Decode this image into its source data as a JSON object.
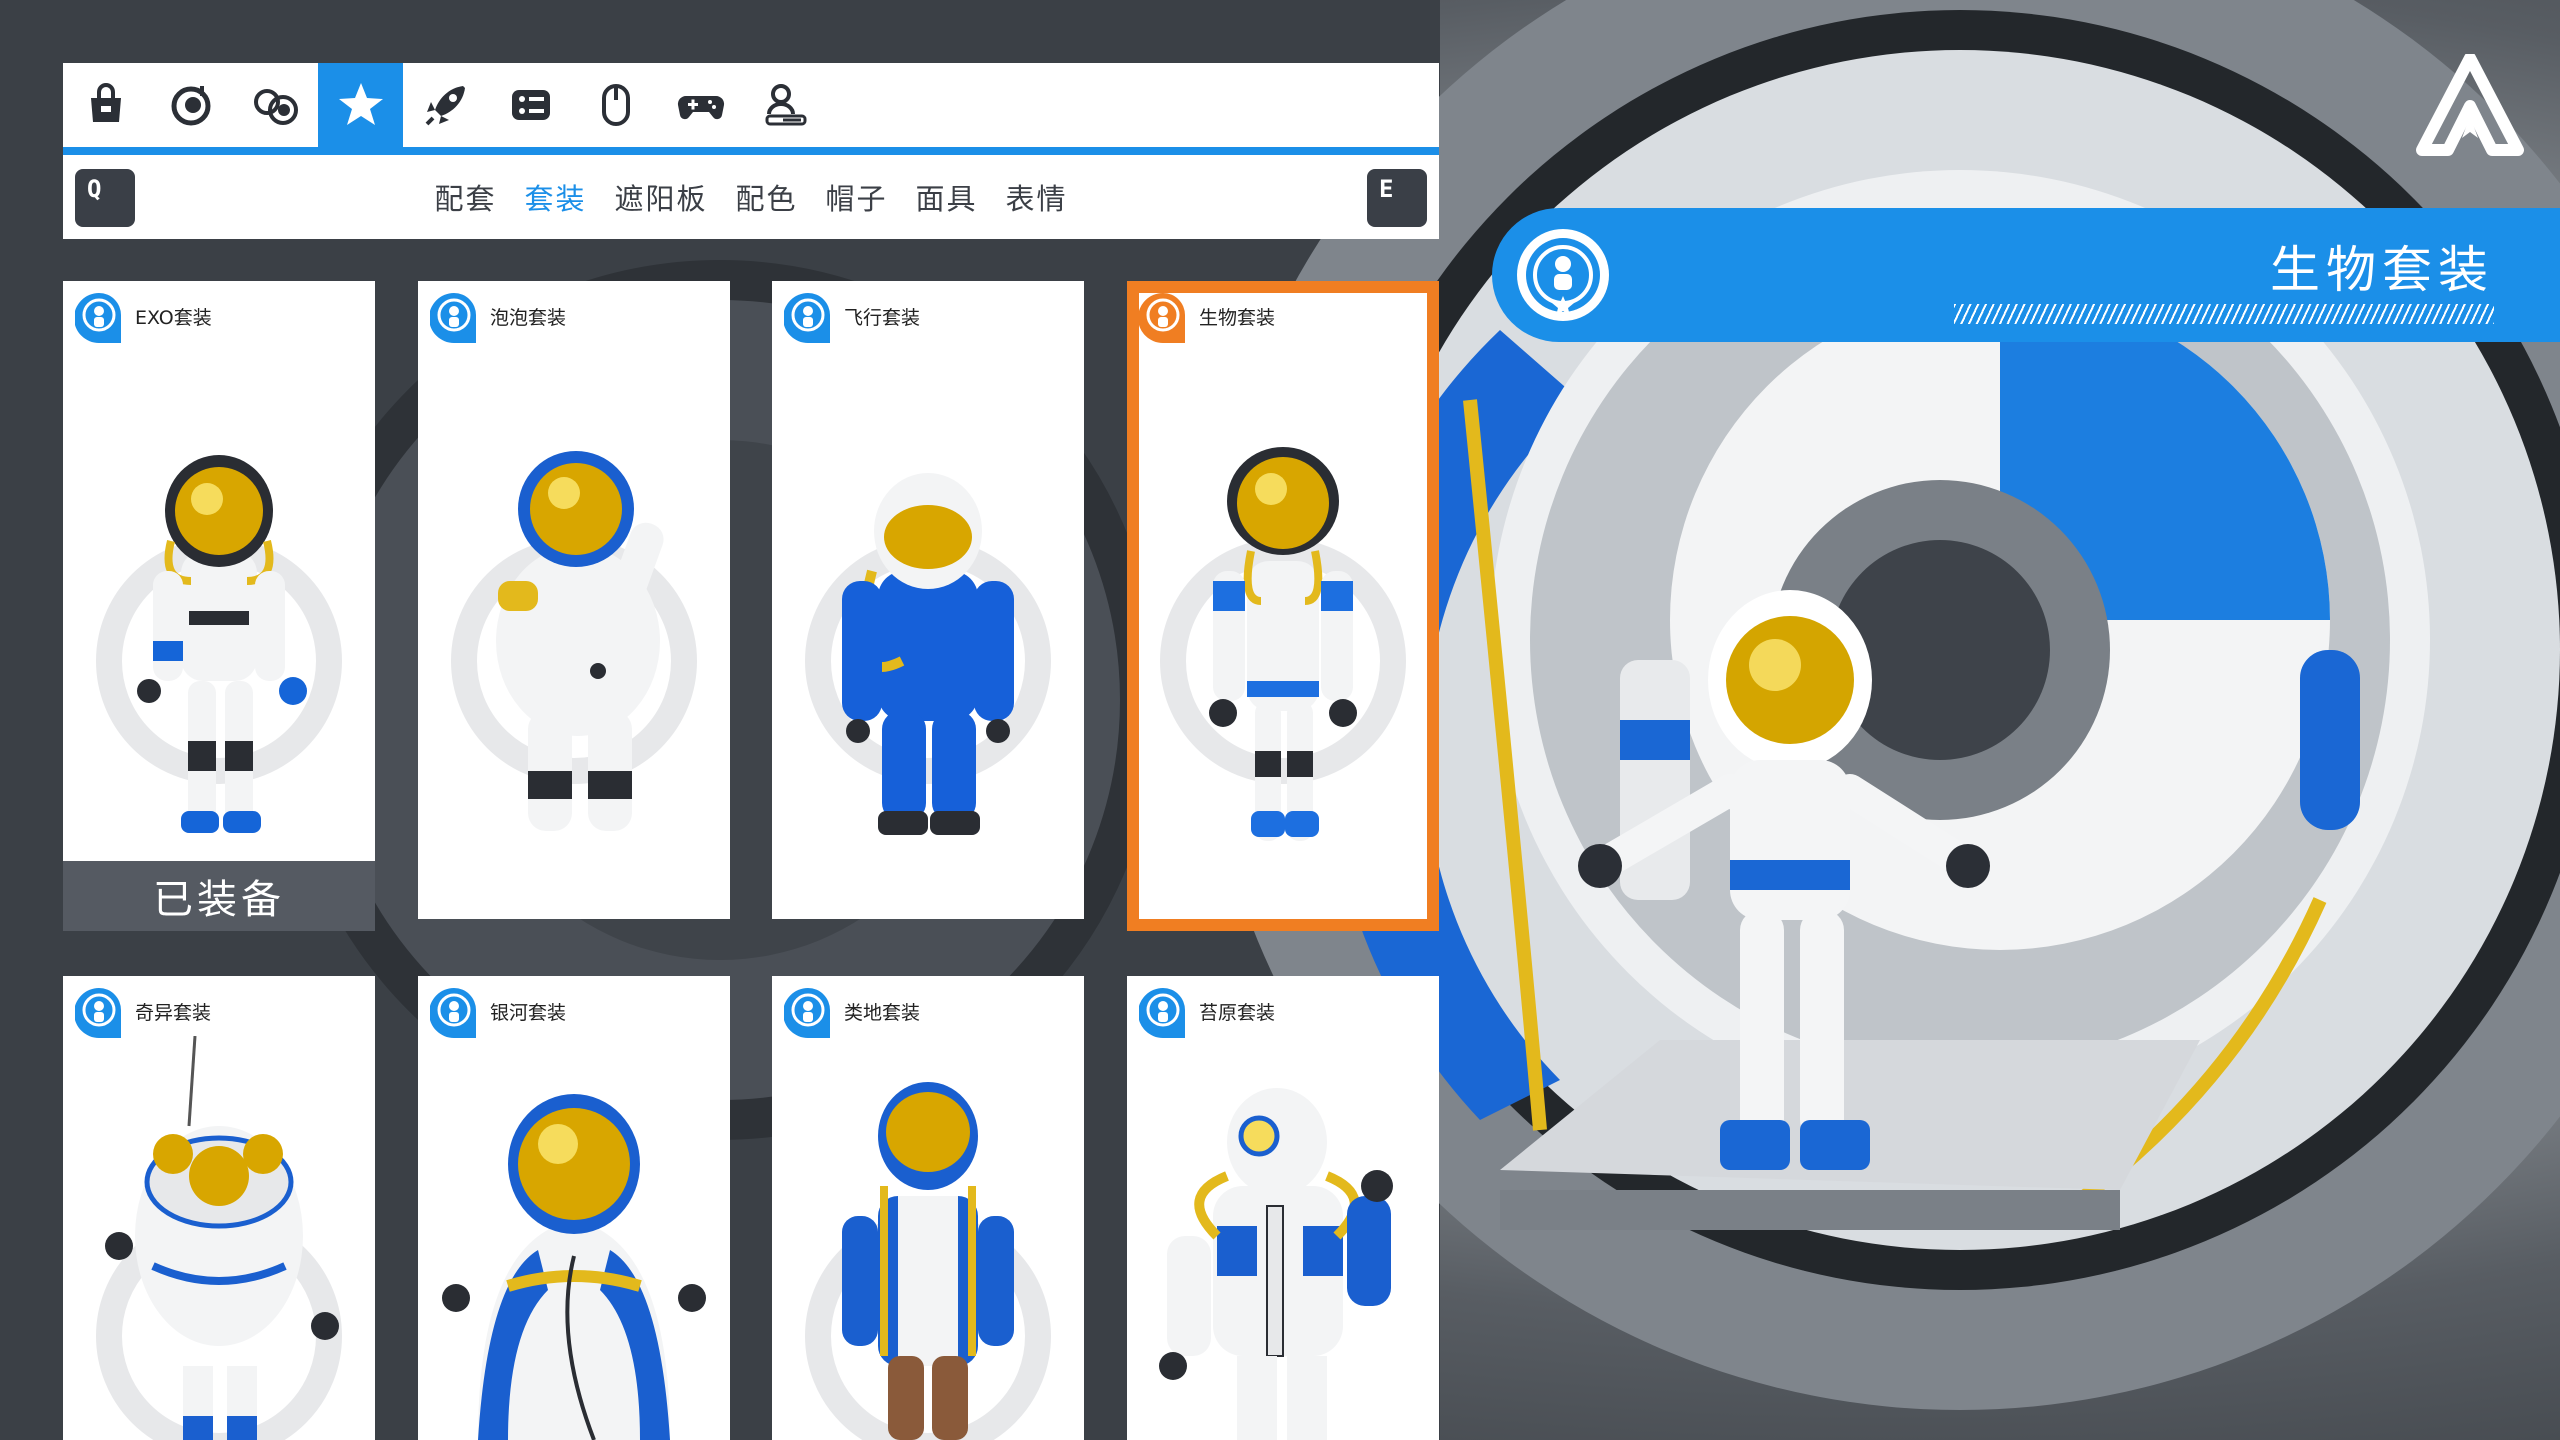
{
  "category_bar": {
    "items": [
      {
        "icon": "bag-icon",
        "active": false
      },
      {
        "icon": "astronaut-head-icon",
        "active": false
      },
      {
        "icon": "astronaut-pair-icon",
        "active": false
      },
      {
        "icon": "star-icon",
        "active": true
      },
      {
        "icon": "rocket-icon",
        "active": false
      },
      {
        "icon": "settings-panel-icon",
        "active": false
      },
      {
        "icon": "mouse-icon",
        "active": false
      },
      {
        "icon": "gamepad-icon",
        "active": false
      },
      {
        "icon": "account-icon",
        "active": false
      }
    ]
  },
  "tab_bar": {
    "prev_key": "Q",
    "next_key": "E",
    "tabs": [
      {
        "label": "配套",
        "active": false
      },
      {
        "label": "套装",
        "active": true
      },
      {
        "label": "遮阳板",
        "active": false
      },
      {
        "label": "配色",
        "active": false
      },
      {
        "label": "帽子",
        "active": false
      },
      {
        "label": "面具",
        "active": false
      },
      {
        "label": "表情",
        "active": false
      }
    ]
  },
  "suits": [
    {
      "name": "EXO套装",
      "status": "已装备",
      "selected": false,
      "suit_color": "#1565d8",
      "badge_color": "#1b8fe8"
    },
    {
      "name": "泡泡套装",
      "status": "",
      "selected": false,
      "suit_color": "#1a5fcf",
      "badge_color": "#1b8fe8"
    },
    {
      "name": "飞行套装",
      "status": "",
      "selected": false,
      "suit_color": "#1660d9",
      "badge_color": "#1b8fe8"
    },
    {
      "name": "生物套装",
      "status": "",
      "selected": true,
      "suit_color": "#1d6fe0",
      "badge_color": "#f07e22"
    },
    {
      "name": "奇异套装",
      "status": "",
      "selected": false,
      "suit_color": "#1a5fcf",
      "badge_color": "#1b8fe8"
    },
    {
      "name": "银河套装",
      "status": "",
      "selected": false,
      "suit_color": "#1a5fcf",
      "badge_color": "#1b8fe8"
    },
    {
      "name": "类地套装",
      "status": "",
      "selected": false,
      "suit_color": "#1a5fcf",
      "badge_color": "#1b8fe8"
    },
    {
      "name": "苔原套装",
      "status": "",
      "selected": false,
      "suit_color": "#1a5fcf",
      "badge_color": "#1b8fe8"
    }
  ],
  "info_banner": {
    "title": "生物套装",
    "icon": "astronaut-badge-icon"
  },
  "logo": {
    "icon": "astroneer-logo-icon"
  },
  "colors": {
    "accent": "#1b8fe8",
    "selected_outline": "#f07e22",
    "equipped_bar": "#555a62",
    "visor_gold": "#e6b400"
  }
}
